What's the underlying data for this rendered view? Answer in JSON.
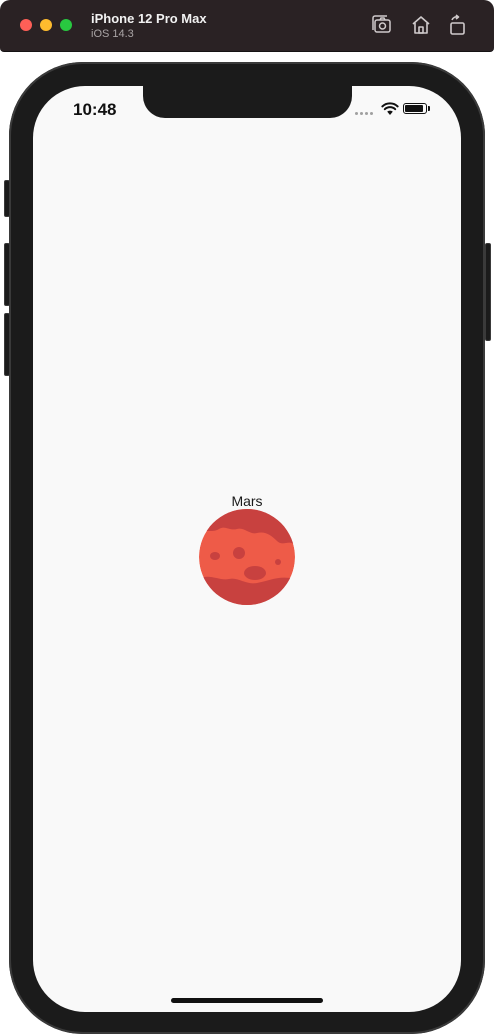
{
  "simulator": {
    "device_name": "iPhone 12 Pro Max",
    "os_version": "iOS 14.3",
    "toolbar_icons": [
      "screenshot-icon",
      "home-icon",
      "rotate-icon"
    ]
  },
  "status_bar": {
    "time": "10:48",
    "battery_level": 0.95
  },
  "content": {
    "planet_name": "Mars",
    "planet_colors": {
      "surface": "#ee5b48",
      "dark": "#c8413f"
    }
  },
  "colors": {
    "titlebar": "#2a2224",
    "frame": "#1b1b1b",
    "screen": "#f9f9f9"
  }
}
